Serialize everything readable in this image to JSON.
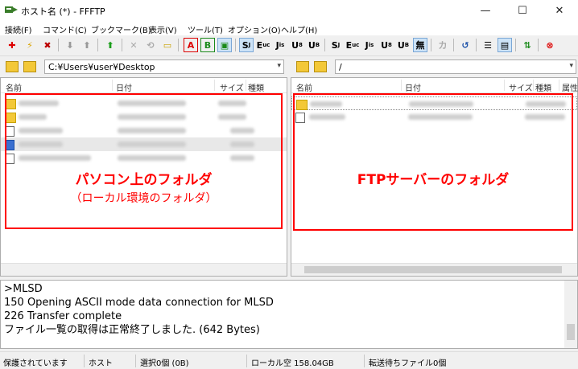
{
  "window": {
    "title": "ホスト名 (*) - FFFTP",
    "minimize": "—",
    "maximize": "☐",
    "close": "✕"
  },
  "menu": [
    "接続(F)",
    "コマンド(C)",
    "ブックマーク(B)",
    "表示(V)",
    "ツール(T)",
    "オプション(O)",
    "ヘルプ(H)"
  ],
  "toolbar": {
    "s1": "S",
    "e": "E",
    "j": "J",
    "u1": "U",
    "u2": "U",
    "s2": "S",
    "e2": "E",
    "j2": "J",
    "u3": "U",
    "u4": "U",
    "mu": "無",
    "ka": "カ",
    "a": "A",
    "b": "B"
  },
  "local": {
    "path": "C:¥Users¥user¥Desktop",
    "columns": {
      "name": "名前",
      "date": "日付",
      "size": "サイズ",
      "type": "種類"
    },
    "annotation_title": "パソコン上のフォルダ",
    "annotation_subtitle": "（ローカル環境のフォルダ）"
  },
  "remote": {
    "path": "/",
    "columns": {
      "name": "名前",
      "date": "日付",
      "size": "サイズ",
      "type": "種類",
      "attr": "属性"
    },
    "annotation_title": "FTPサーバーのフォルダ"
  },
  "log": {
    "lines": [
      ">MLSD",
      "150 Opening ASCII mode data connection for MLSD",
      "226 Transfer complete",
      "ファイル一覧の取得は正常終了しました. (642 Bytes)"
    ]
  },
  "status": {
    "protect": "保護されています",
    "host": "ホスト",
    "selected": "選択0個 (0B)",
    "local_free": "ローカル空 158.04GB",
    "queue": "転送待ちファイル0個"
  },
  "colors": {
    "annotation": "#ff0000",
    "folder": "#f3c838",
    "selected_row": "#e8e8e8"
  }
}
